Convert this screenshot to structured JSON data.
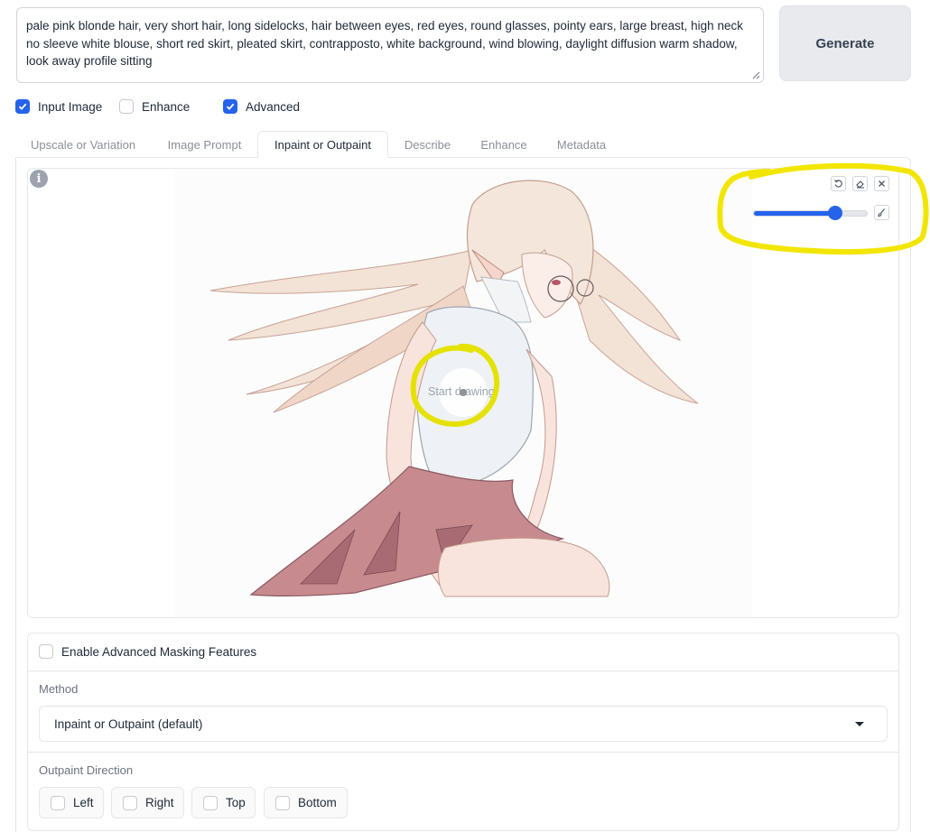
{
  "prompt": {
    "value": "pale pink blonde hair, very short hair, long sidelocks, hair between eyes, red eyes, round glasses, pointy ears, large breast, high neck no sleeve white blouse, short red skirt, pleated skirt, contrapposto, white background, wind blowing, daylight diffusion warm shadow, look away profile sitting"
  },
  "generate_label": "Generate",
  "options": [
    {
      "label": "Input Image",
      "checked": true
    },
    {
      "label": "Enhance",
      "checked": false
    },
    {
      "label": "Advanced",
      "checked": true
    }
  ],
  "tabs": [
    {
      "label": "Upscale or Variation",
      "active": false
    },
    {
      "label": "Image Prompt",
      "active": false
    },
    {
      "label": "Inpaint or Outpaint",
      "active": true
    },
    {
      "label": "Describe",
      "active": false
    },
    {
      "label": "Enhance",
      "active": false
    },
    {
      "label": "Metadata",
      "active": false
    }
  ],
  "canvas": {
    "info_glyph": "i",
    "overlay_text": "Start drawing",
    "brush_size_fraction": 0.72,
    "tools": [
      "undo-icon",
      "eraser-icon",
      "close-icon",
      "brush-icon"
    ]
  },
  "annotation_color": "#f2e600",
  "masking": {
    "enable_label": "Enable Advanced Masking Features",
    "enable_checked": false,
    "method_label": "Method",
    "method_value": "Inpaint or Outpaint (default)",
    "direction_label": "Outpaint Direction",
    "directions": [
      {
        "label": "Left",
        "checked": false
      },
      {
        "label": "Right",
        "checked": false
      },
      {
        "label": "Top",
        "checked": false
      },
      {
        "label": "Bottom",
        "checked": false
      }
    ]
  },
  "colors": {
    "accent": "#2563eb",
    "generate_bg": "#e9eaee"
  }
}
